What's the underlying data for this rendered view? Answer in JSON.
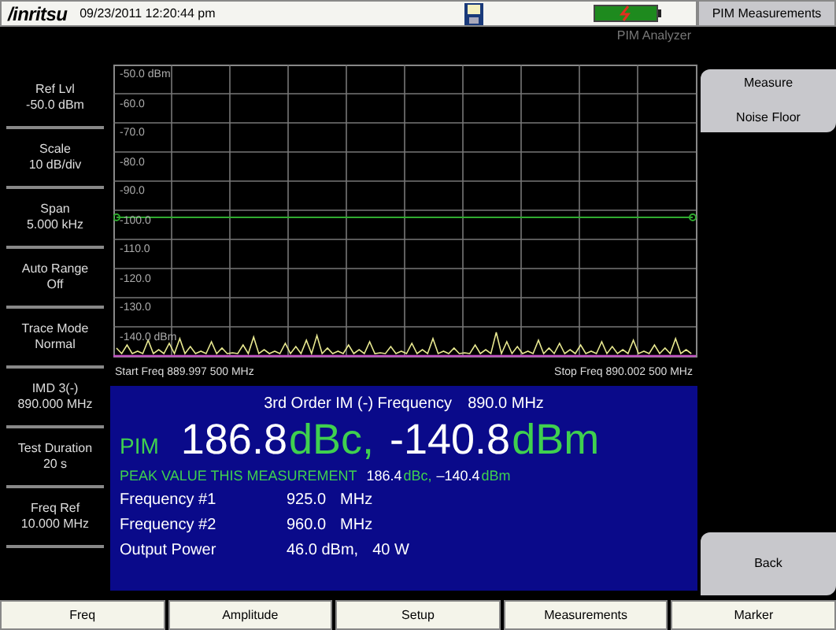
{
  "header": {
    "logo": "/inritsu",
    "date_time": "09/23/2011 12:20:44 pm",
    "mode": "PIM Analyzer"
  },
  "left_panel": [
    {
      "label": "Ref Lvl",
      "value": "-50.0 dBm"
    },
    {
      "label": "Scale",
      "value": "10 dB/div"
    },
    {
      "label": "Span",
      "value": "5.000 kHz"
    },
    {
      "label": "Auto Range",
      "value": "Off"
    },
    {
      "label": "Trace Mode",
      "value": "Normal"
    },
    {
      "label": "IMD 3(-)",
      "value": "890.000 MHz"
    },
    {
      "label": "Test Duration",
      "value": "20 s"
    },
    {
      "label": "Freq Ref",
      "value": "10.000 MHz"
    }
  ],
  "graph": {
    "y_labels": [
      "-50.0 dBm",
      "-60.0",
      "-70.0",
      "-80.0",
      "-90.0",
      "-100.0",
      "-110.0",
      "-120.0",
      "-130.0",
      "-140.0 dBm"
    ],
    "start": "Start Freq 889.997 500 MHz",
    "stop": "Stop Freq 890.002 500 MHz"
  },
  "results": {
    "title": "3rd Order IM (-) Frequency",
    "title_value": "890.0 MHz",
    "pim_label": "PIM",
    "pim_dbc": "186.8",
    "dbc_unit": "dBc,",
    "pim_dbm": "-140.8",
    "dbm_unit": "dBm",
    "peak_label": "PEAK VALUE THIS MEASUREMENT",
    "peak_dbc": "186.4",
    "peak_dbc_unit": "dBc,",
    "peak_dbm": "–140.4",
    "peak_dbm_unit": "dBm",
    "rows": [
      {
        "label": "Frequency #1",
        "value": "925.0",
        "unit": "MHz"
      },
      {
        "label": "Frequency #2",
        "value": "960.0",
        "unit": "MHz"
      },
      {
        "label": "Output Power",
        "value": "46.0 dBm,",
        "unit": "40 W"
      }
    ]
  },
  "menu": {
    "title": "PIM Measurements",
    "keys": [
      {
        "lines": [
          "Measure",
          "Noise Floor"
        ]
      },
      {
        "lines": [
          "Back"
        ]
      }
    ]
  },
  "tabs": [
    "Freq",
    "Amplitude",
    "Setup",
    "Measurements",
    "Marker"
  ]
}
